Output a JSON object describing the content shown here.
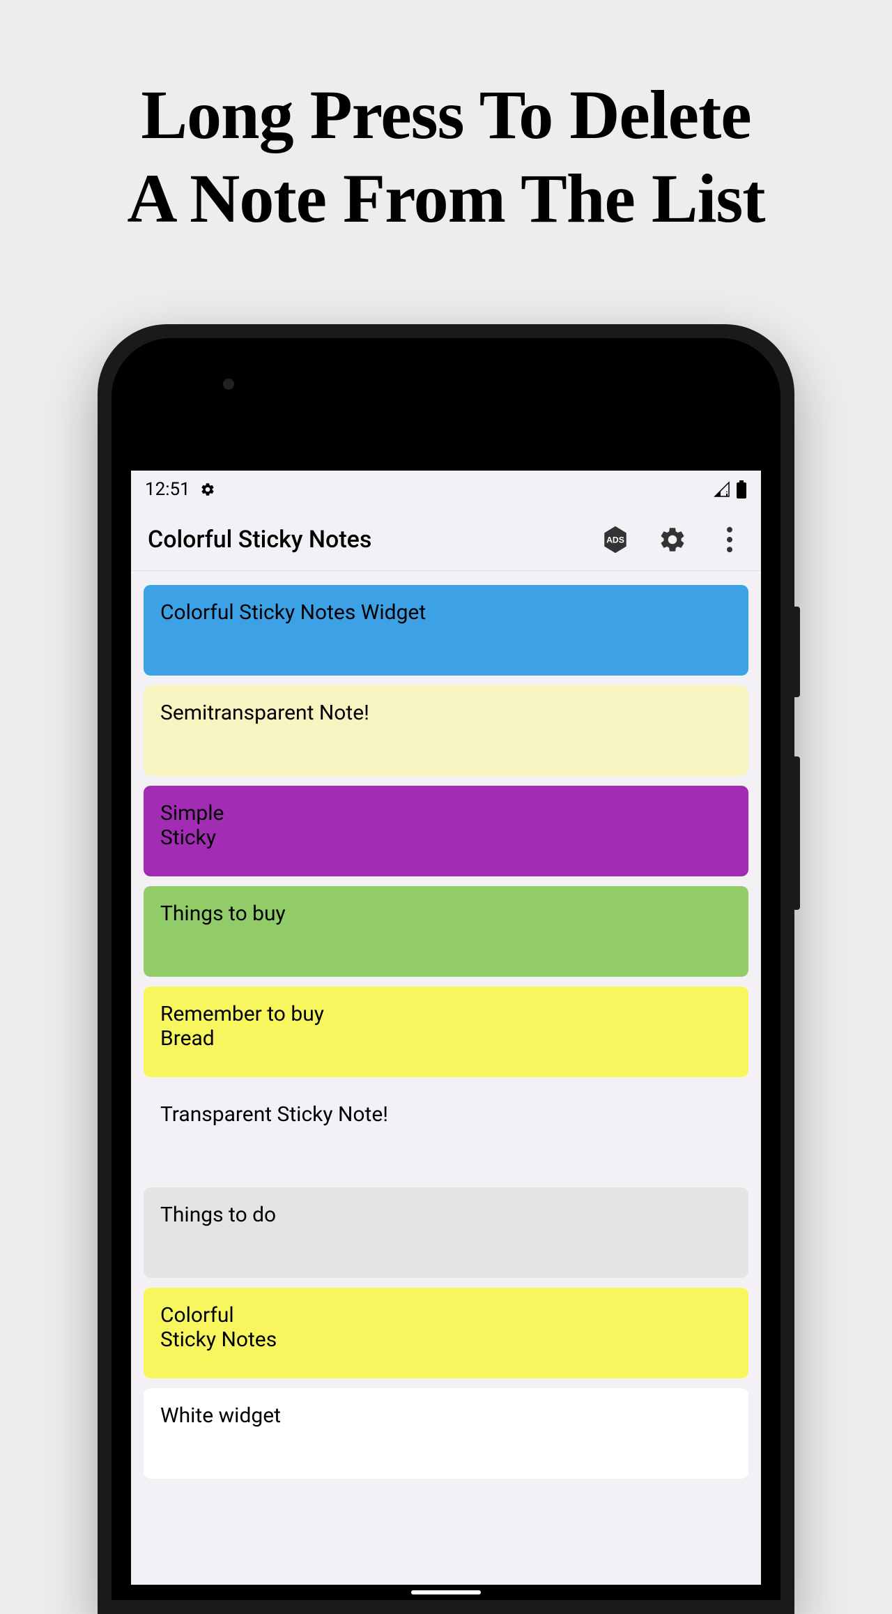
{
  "headline": {
    "line1": "Long Press To Delete",
    "line2": "A Note From The List"
  },
  "statusBar": {
    "time": "12:51"
  },
  "appBar": {
    "title": "Colorful Sticky Notes"
  },
  "notes": [
    {
      "text": "Colorful Sticky Notes Widget",
      "color": "#3da1e6"
    },
    {
      "text": "Semitransparent Note!",
      "color": "#f7f4c1"
    },
    {
      "text": "Simple\nSticky",
      "color": "#a22cb4"
    },
    {
      "text": "Things to buy",
      "color": "#92cc69"
    },
    {
      "text": "Remember to buy\nBread",
      "color": "#f8f65f"
    },
    {
      "text": "Transparent Sticky Note!",
      "color": "transparent"
    },
    {
      "text": "Things to do",
      "color": "#e4e4e4"
    },
    {
      "text": "Colorful\nSticky Notes",
      "color": "#f8f65f"
    },
    {
      "text": "White widget",
      "color": "#ffffff"
    }
  ]
}
